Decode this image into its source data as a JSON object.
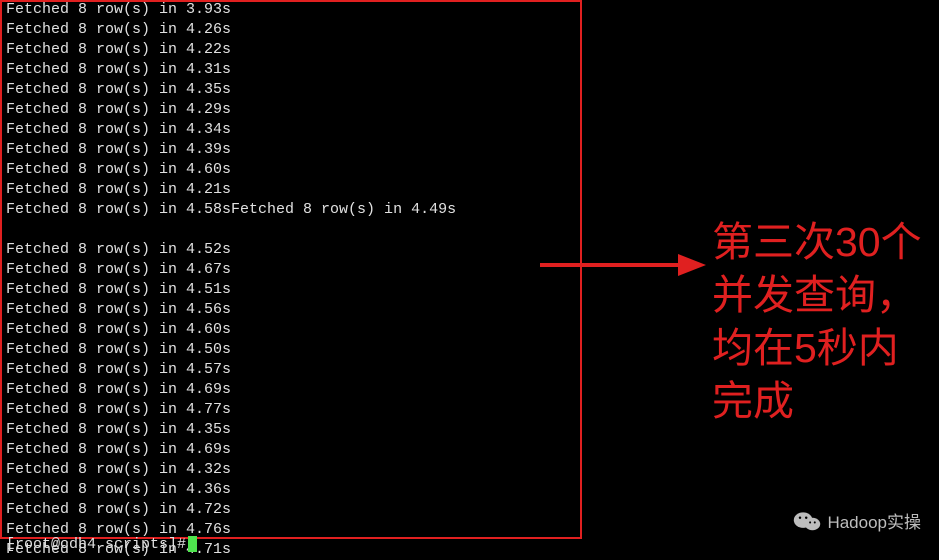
{
  "terminal": {
    "lines": [
      "Fetched 8 row(s) in 3.93s",
      "Fetched 8 row(s) in 4.26s",
      "Fetched 8 row(s) in 4.22s",
      "Fetched 8 row(s) in 4.31s",
      "Fetched 8 row(s) in 4.35s",
      "Fetched 8 row(s) in 4.29s",
      "Fetched 8 row(s) in 4.34s",
      "Fetched 8 row(s) in 4.39s",
      "Fetched 8 row(s) in 4.60s",
      "Fetched 8 row(s) in 4.21s",
      "Fetched 8 row(s) in 4.58sFetched 8 row(s) in 4.49s",
      "",
      "Fetched 8 row(s) in 4.52s",
      "Fetched 8 row(s) in 4.67s",
      "Fetched 8 row(s) in 4.51s",
      "Fetched 8 row(s) in 4.56s",
      "Fetched 8 row(s) in 4.60s",
      "Fetched 8 row(s) in 4.50s",
      "Fetched 8 row(s) in 4.57s",
      "Fetched 8 row(s) in 4.69s",
      "Fetched 8 row(s) in 4.77s",
      "Fetched 8 row(s) in 4.35s",
      "Fetched 8 row(s) in 4.69s",
      "Fetched 8 row(s) in 4.32s",
      "Fetched 8 row(s) in 4.36s",
      "Fetched 8 row(s) in 4.72s",
      "Fetched 8 row(s) in 4.76s",
      "Fetched 8 row(s) in 4.71s"
    ],
    "prompt": "[root@cdh4 scripts]#"
  },
  "annotation": {
    "text": "第三次30个并发查询，均在5秒内完成",
    "color": "#e02020"
  },
  "watermark": {
    "text": "Hadoop实操"
  }
}
